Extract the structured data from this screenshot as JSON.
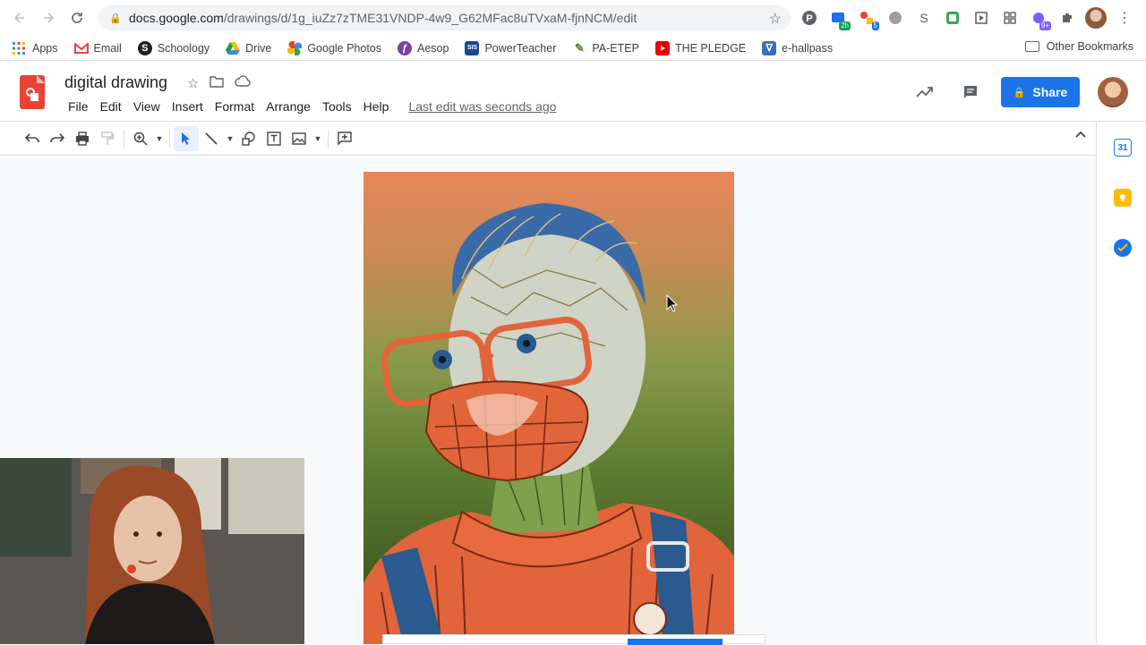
{
  "browser": {
    "url_host": "docs.google.com",
    "url_path": "/drawings/d/1g_iuZz7zTME31VNDP-4w9_G62MFac8uTVxaM-fjnNCM/edit",
    "extension_badges": [
      "2h",
      "5",
      "9+"
    ]
  },
  "bookmarks": {
    "items": [
      {
        "label": "Apps",
        "color": "#4285f4"
      },
      {
        "label": "Email",
        "color": "#ea4335"
      },
      {
        "label": "Schoology",
        "color": "#202124"
      },
      {
        "label": "Drive",
        "color": "#0f9d58"
      },
      {
        "label": "Google Photos",
        "color": "#fbbc04"
      },
      {
        "label": "Aesop",
        "color": "#7b3fa0"
      },
      {
        "label": "PowerTeacher",
        "color": "#1a4a8a"
      },
      {
        "label": "PA-ETEP",
        "color": "#5a8a2a"
      },
      {
        "label": "THE PLEDGE",
        "color": "#ea0000"
      },
      {
        "label": "e-hallpass",
        "color": "#3a6ec0"
      }
    ],
    "other": "Other Bookmarks"
  },
  "docs": {
    "title": "digital drawing",
    "menu": [
      "File",
      "Edit",
      "View",
      "Insert",
      "Format",
      "Arrange",
      "Tools",
      "Help"
    ],
    "last_edit": "Last edit was seconds ago",
    "share_label": "Share"
  },
  "colors": {
    "accent": "#1a73e8",
    "drawings_red": "#ea4335"
  }
}
